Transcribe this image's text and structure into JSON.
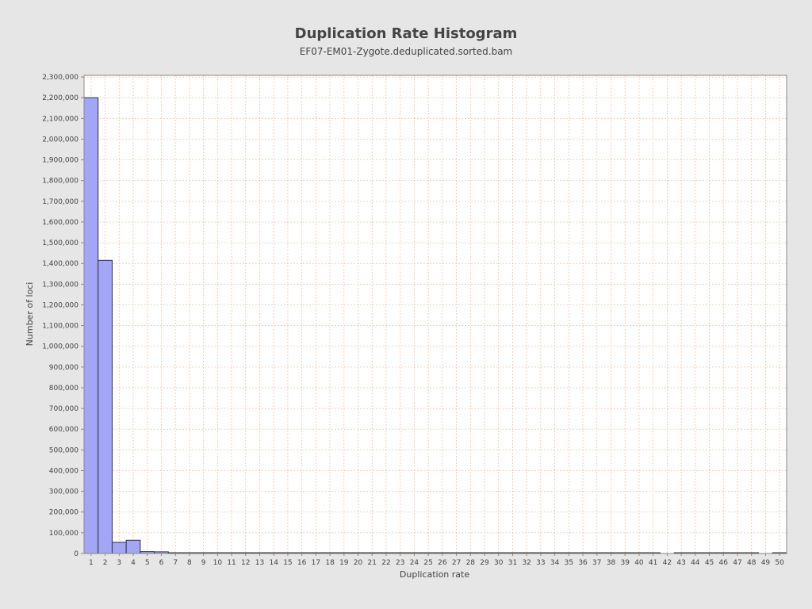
{
  "chart_data": {
    "type": "bar",
    "title": "Duplication Rate Histogram",
    "subtitle": "EF07-EM01-Zygote.deduplicated.sorted.bam",
    "xlabel": "Duplication rate",
    "ylabel": "Number of loci",
    "categories": [
      "1",
      "2",
      "3",
      "4",
      "5",
      "6",
      "7",
      "8",
      "9",
      "10",
      "11",
      "12",
      "13",
      "14",
      "15",
      "16",
      "17",
      "18",
      "19",
      "20",
      "21",
      "22",
      "23",
      "24",
      "25",
      "26",
      "27",
      "28",
      "29",
      "30",
      "31",
      "32",
      "33",
      "34",
      "35",
      "36",
      "37",
      "38",
      "39",
      "40",
      "41",
      "42",
      "43",
      "44",
      "45",
      "46",
      "47",
      "48",
      "49",
      "50"
    ],
    "values": [
      2200000,
      1415000,
      54000,
      64000,
      9000,
      8000,
      2000,
      1200,
      900,
      700,
      600,
      500,
      450,
      400,
      380,
      350,
      320,
      300,
      280,
      260,
      240,
      220,
      200,
      190,
      180,
      170,
      160,
      150,
      140,
      130,
      120,
      110,
      100,
      95,
      90,
      85,
      80,
      75,
      70,
      65,
      60,
      0,
      50,
      45,
      40,
      35,
      30,
      25,
      0,
      500
    ],
    "ylim": [
      0,
      2300000
    ],
    "yticks": [
      0,
      100000,
      200000,
      300000,
      400000,
      500000,
      600000,
      700000,
      800000,
      900000,
      1000000,
      1100000,
      1200000,
      1300000,
      1400000,
      1500000,
      1600000,
      1700000,
      1800000,
      1900000,
      2000000,
      2100000,
      2200000,
      2300000
    ],
    "ytick_labels": [
      "0",
      "100,000",
      "200,000",
      "300,000",
      "400,000",
      "500,000",
      "600,000",
      "700,000",
      "800,000",
      "900,000",
      "1,000,000",
      "1,100,000",
      "1,200,000",
      "1,300,000",
      "1,400,000",
      "1,500,000",
      "1,600,000",
      "1,700,000",
      "1,800,000",
      "1,900,000",
      "2,000,000",
      "2,100,000",
      "2,200,000",
      "2,300,000"
    ],
    "grid": true,
    "legend": "none",
    "colors": {
      "background": "#e6e6e6",
      "plot_background": "#ffffff",
      "bar_fill": "#a3a6f7",
      "bar_stroke": "#333333",
      "grid": "#f2c3a2",
      "axis": "#888888"
    }
  }
}
